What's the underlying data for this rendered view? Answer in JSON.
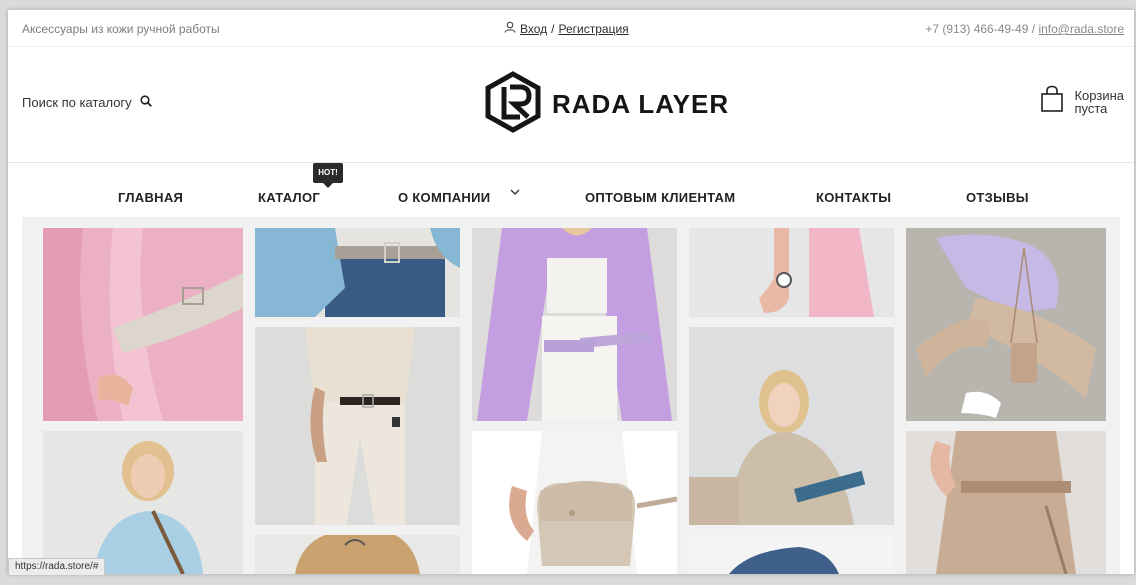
{
  "topbar": {
    "tagline": "Аксессуары из кожи ручной работы",
    "login": "Вход",
    "separator": "/",
    "register": "Регистрация",
    "phone": "+7 (913) 466-49-49",
    "contact_separator": "/",
    "email": "info@rada.store"
  },
  "header": {
    "search_label": "Поиск по каталогу",
    "brand": "RADA LAYER",
    "cart_line1": "Корзина",
    "cart_line2": "пуста"
  },
  "nav": {
    "items": [
      "ГЛАВНАЯ",
      "КАТАЛОГ",
      "О КОМПАНИИ",
      "ОПТОВЫМ КЛИЕНТАМ",
      "КОНТАКТЫ",
      "ОТЗЫВЫ"
    ],
    "badge": "HOT!"
  },
  "status_bar": {
    "url": "https://rada.store/#"
  },
  "colors": {
    "text_dark": "#222222",
    "pink_outfit": "#efb4c8",
    "lavender": "#c7a8e0",
    "denim": "#3d5c85",
    "beige": "#d8cab8",
    "sky_blue": "#9fc8e2"
  }
}
